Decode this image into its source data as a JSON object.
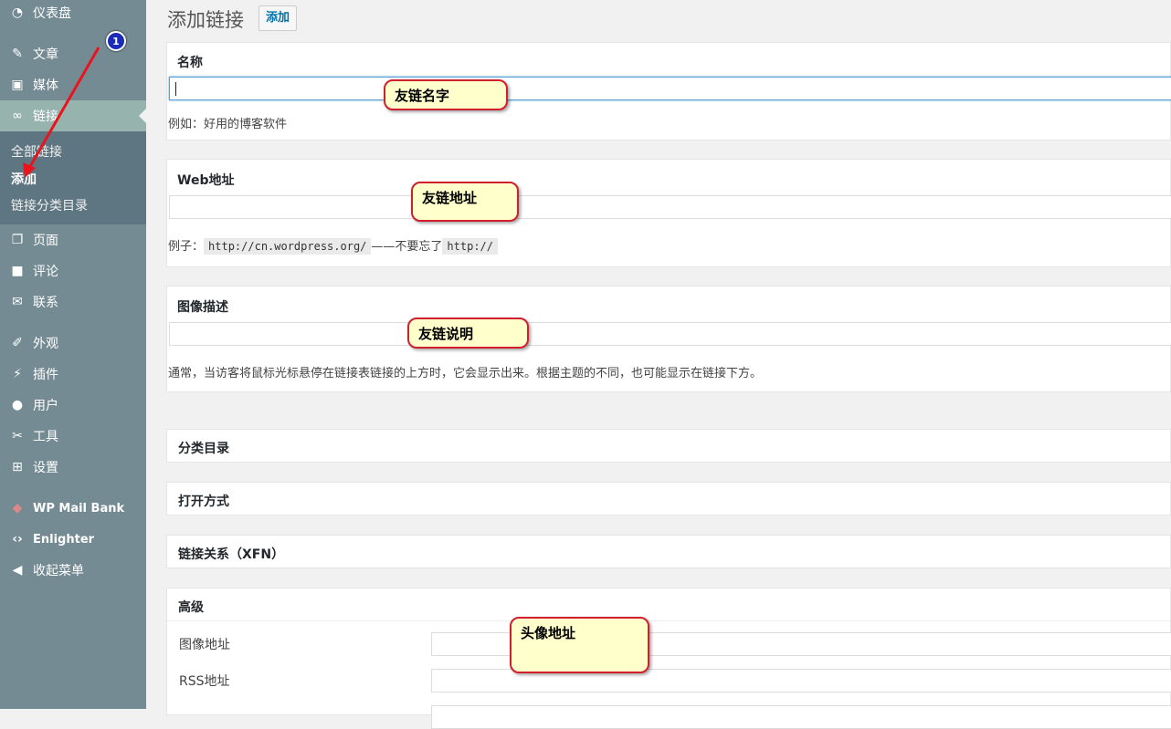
{
  "sidebar": {
    "items": [
      {
        "label": "仪表盘",
        "icon": "dashboard-icon"
      },
      {
        "label": "文章",
        "icon": "pin-icon"
      },
      {
        "label": "媒体",
        "icon": "media-icon"
      },
      {
        "label": "链接",
        "icon": "link-icon"
      },
      {
        "label": "页面",
        "icon": "pages-icon"
      },
      {
        "label": "评论",
        "icon": "comment-icon"
      },
      {
        "label": "联系",
        "icon": "mail-icon"
      },
      {
        "label": "外观",
        "icon": "brush-icon"
      },
      {
        "label": "插件",
        "icon": "plugin-icon"
      },
      {
        "label": "用户",
        "icon": "user-icon"
      },
      {
        "label": "工具",
        "icon": "wrench-icon"
      },
      {
        "label": "设置",
        "icon": "settings-icon"
      },
      {
        "label": "WP Mail Bank",
        "icon": "mail-bank-icon"
      },
      {
        "label": "Enlighter",
        "icon": "code-icon"
      },
      {
        "label": "收起菜单",
        "icon": "collapse-icon"
      }
    ],
    "submenu": [
      {
        "label": "全部链接"
      },
      {
        "label": "添加"
      },
      {
        "label": "链接分类目录"
      }
    ]
  },
  "header": {
    "title": "添加链接",
    "add_button": "添加"
  },
  "name_box": {
    "title": "名称",
    "value": "",
    "help": "例如：好用的博客软件",
    "callout": "友链名字"
  },
  "url_box": {
    "title": "Web地址",
    "value": "",
    "help_prefix": "例子：",
    "help_code1": "http://cn.wordpress.org/",
    "help_middle": "——不要忘了",
    "help_code2": "http://",
    "callout": "友链地址"
  },
  "desc_box": {
    "title": "图像描述",
    "value": "",
    "help": "通常，当访客将鼠标光标悬停在链接表链接的上方时，它会显示出来。根据主题的不同，也可能显示在链接下方。",
    "callout": "友链说明"
  },
  "collapsed": [
    {
      "title": "分类目录"
    },
    {
      "title": "打开方式"
    },
    {
      "title": "链接关系（XFN）"
    }
  ],
  "advanced": {
    "title": "高级",
    "image_label": "图像地址",
    "rss_label": "RSS地址",
    "callout": "头像地址"
  },
  "annotation": {
    "badge": "1"
  },
  "colors": {
    "sidebar": "#748b93",
    "active": "#97b3ae",
    "submenu": "#5e7681",
    "link": "#0073aa",
    "callout_bg": "#ffffcc",
    "callout_border": "#d21f2e",
    "arrow": "#e8151f",
    "badge": "#1a2bb8"
  }
}
